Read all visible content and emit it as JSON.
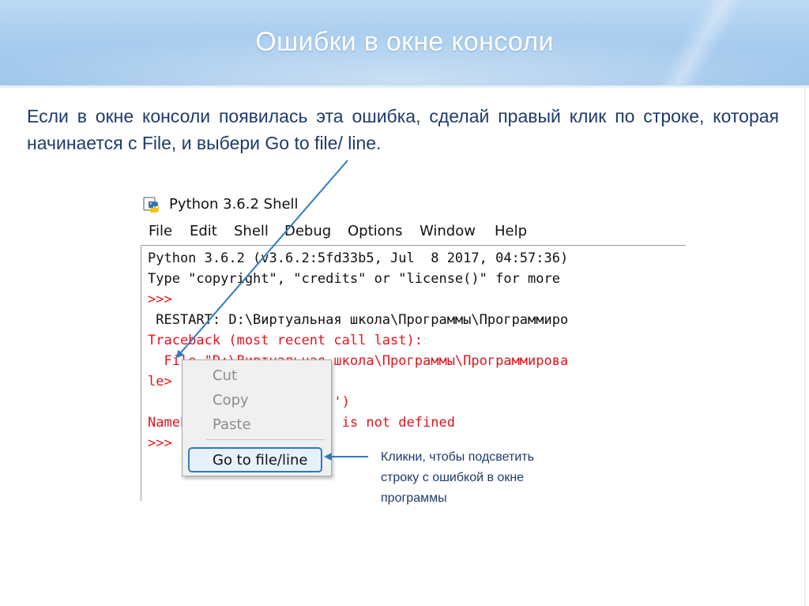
{
  "slide": {
    "title": "Ошибки в окне консоли",
    "intro": "Если в окне консоли появилась эта ошибка, сделай правый клик по строке, которая начинается с File, и выбери Go to file/ line."
  },
  "window": {
    "title": "Python 3.6.2 Shell",
    "menu": [
      "File",
      "Edit",
      "Shell",
      "Debug",
      "Options",
      "Window",
      "Help"
    ]
  },
  "console": {
    "lines": [
      {
        "text": "Python 3.6.2 (v3.6.2:5fd33b5, Jul  8 2017, 04:57:36)",
        "color": "black"
      },
      {
        "text": "Type \"copyright\", \"credits\" or \"license()\" for more",
        "color": "black"
      },
      {
        "text": ">>>",
        "color": "red"
      },
      {
        "text": " RESTART: D:\\Виртуальная школа\\Программы\\Программиро",
        "color": "black"
      },
      {
        "text": "Traceback (most recent call last):",
        "color": "red"
      },
      {
        "text": "  File \"D:\\Виртуальная школа\\Программы\\Программирова",
        "color": "red"
      },
      {
        "text": "le>",
        "color": "red"
      },
      {
        "text": "                 World!')",
        "color": "red"
      },
      {
        "text": "NameError: name 'pront' is not defined",
        "color": "red"
      },
      {
        "text": ">>>",
        "color": "red"
      }
    ]
  },
  "context_menu": {
    "items": [
      "Cut",
      "Copy",
      "Paste"
    ],
    "highlighted": "Go to file/line"
  },
  "callout": {
    "text": "Кликни, чтобы подсветить строку с ошибкой в окне программы"
  },
  "colors": {
    "title_text": "#ffffff",
    "body_text": "#1f3a6b",
    "console_red": "#e0141e",
    "arrow_blue": "#2f79c7"
  }
}
